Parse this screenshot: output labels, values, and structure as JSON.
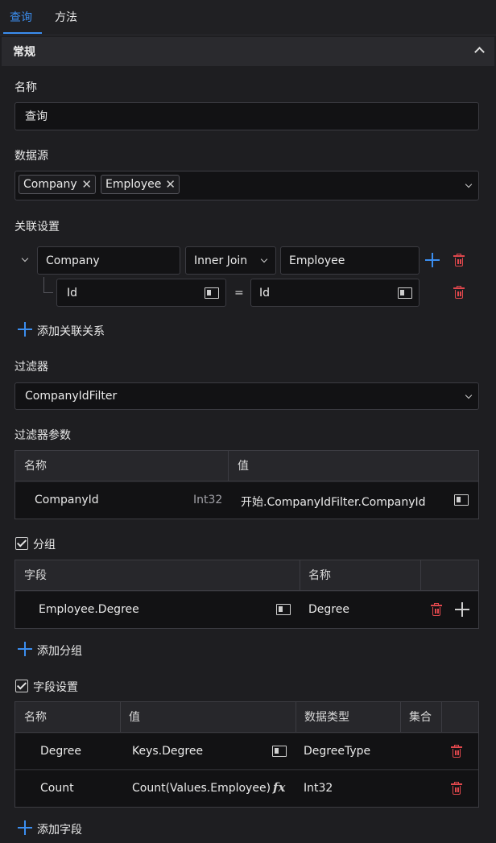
{
  "tabs": [
    {
      "label": "查询"
    },
    {
      "label": "方法"
    }
  ],
  "section": {
    "title": "常规"
  },
  "name_field": {
    "label": "名称",
    "value": "查询"
  },
  "datasource": {
    "label": "数据源",
    "tags": [
      "Company",
      "Employee"
    ]
  },
  "join": {
    "label": "关联设置",
    "left": "Company",
    "type": "Inner Join",
    "right": "Employee",
    "cond_left": "Id",
    "operator": "=",
    "cond_right": "Id",
    "add_label": "添加关联关系"
  },
  "filter": {
    "label": "过滤器",
    "value": "CompanyIdFilter"
  },
  "filter_params": {
    "label": "过滤器参数",
    "headers": [
      "名称",
      "值"
    ],
    "rows": [
      {
        "name": "CompanyId",
        "type": "Int32",
        "value": "开始.CompanyIdFilter.CompanyId"
      }
    ]
  },
  "grouping": {
    "label": "分组",
    "checked": true,
    "headers": [
      "字段",
      "名称"
    ],
    "rows": [
      {
        "field": "Employee.Degree",
        "name": "Degree"
      }
    ],
    "add_label": "添加分组"
  },
  "fields": {
    "label": "字段设置",
    "checked": true,
    "headers": [
      "名称",
      "值",
      "数据类型",
      "集合"
    ],
    "rows": [
      {
        "name": "Degree",
        "value": "Keys.Degree",
        "type": "DegreeType",
        "value_icon": "binding-icon"
      },
      {
        "name": "Count",
        "value": "Count(Values.Employee)",
        "type": "Int32",
        "value_icon": "fx-icon"
      }
    ],
    "add_label": "添加字段"
  },
  "colors": {
    "accent": "#3b8ef0",
    "danger": "#e0474c",
    "background": "#1e1e21",
    "input_bg": "#121214"
  }
}
